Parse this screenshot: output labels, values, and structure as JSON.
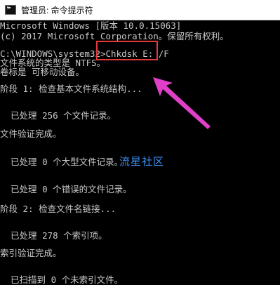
{
  "window": {
    "title": "管理员: 命令提示符",
    "icon": "cmd-icon"
  },
  "console": {
    "lines": [
      "Microsoft Windows [版本 10.0.15063]",
      "(c) 2017 Microsoft Corporation。保留所有权利。",
      "",
      "C:\\WINDOWS\\system32>Chkdsk E: /F",
      "文件系统的类型是 NTFS。",
      "卷标是 可移动设备。",
      "",
      "阶段 1: 检查基本文件系统结构...",
      "",
      "  已处理 256 个文件记录。",
      "文件验证完成。",
      "",
      "  已处理 0 个大型文件记录。",
      "",
      "  已处理 0 个错误的文件记录。",
      "",
      "阶段 2: 检查文件名链接...",
      "",
      "  已处理 278 个索引项。",
      "索引验证完成。",
      "",
      "  已扫描到 0 个未索引文件。"
    ]
  },
  "annotations": {
    "watermark": "流星社区",
    "box_color": "#e43a3a",
    "arrow_color": "#e040c8"
  }
}
